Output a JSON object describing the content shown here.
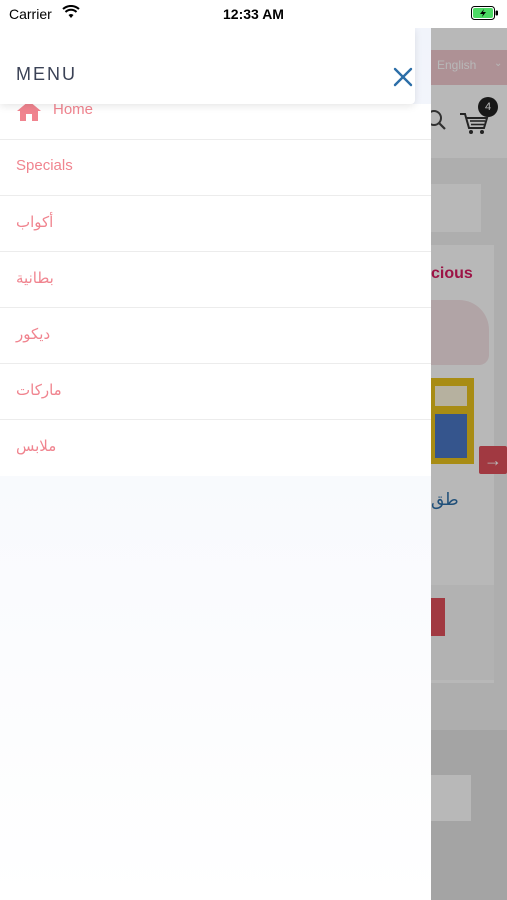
{
  "status_bar": {
    "carrier": "Carrier",
    "time": "12:33 AM"
  },
  "drawer": {
    "title": "MENU",
    "items": [
      {
        "label": "Home",
        "icon": "home-icon"
      },
      {
        "label": "Specials"
      },
      {
        "label": "أكواب"
      },
      {
        "label": "بطانية"
      },
      {
        "label": "ديكور"
      },
      {
        "label": "ماركات"
      },
      {
        "label": "ملابس"
      }
    ]
  },
  "background_app": {
    "language": "English",
    "cart_count": "4",
    "card_title": "cious",
    "price_text": "طق"
  },
  "colors": {
    "menu_text": "#f0848f",
    "accent_blue": "#2c6ea8",
    "header_strip": "#f1c9cf",
    "badge": "#222222"
  }
}
